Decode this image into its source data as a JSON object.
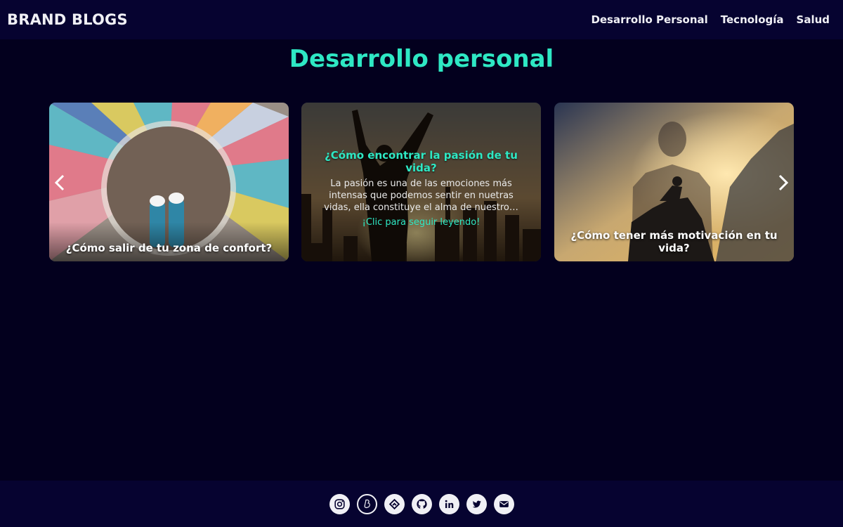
{
  "navbar": {
    "brand": "BRAND BLOGS",
    "links": [
      {
        "label": "Desarrollo Personal"
      },
      {
        "label": "Tecnología"
      },
      {
        "label": "Salud"
      }
    ]
  },
  "main": {
    "title": "Desarrollo personal",
    "cards": [
      {
        "caption": "¿Cómo salir de tu zona de confort?",
        "image": "chalk-drawing-feet-photo"
      },
      {
        "title": "¿Cómo encontrar la pasión de tu vida?",
        "excerpt": "La pasión es una de las emociones más intensas que podemos sentir en nuetras vidas, ella constituye el alma de nuestro…",
        "link": "¡Clic para seguir leyendo!",
        "image": "city-sunset-silhouette-photo"
      },
      {
        "caption": "¿Cómo tener más motivación en tu vida?",
        "image": "climber-silhouette-photo"
      }
    ],
    "carousel": {
      "prev_icon": "chevron-left-icon",
      "next_icon": "chevron-right-icon"
    }
  },
  "footer": {
    "social_icons": [
      "instagram-icon",
      "brandblogs-icon",
      "feedly-icon",
      "github-icon",
      "linkedin-icon",
      "twitter-icon",
      "email-icon"
    ]
  },
  "colors": {
    "background": "#03001e",
    "navbar": "#060330",
    "accent": "#2ee8c4",
    "text": "#f0f0f5"
  }
}
